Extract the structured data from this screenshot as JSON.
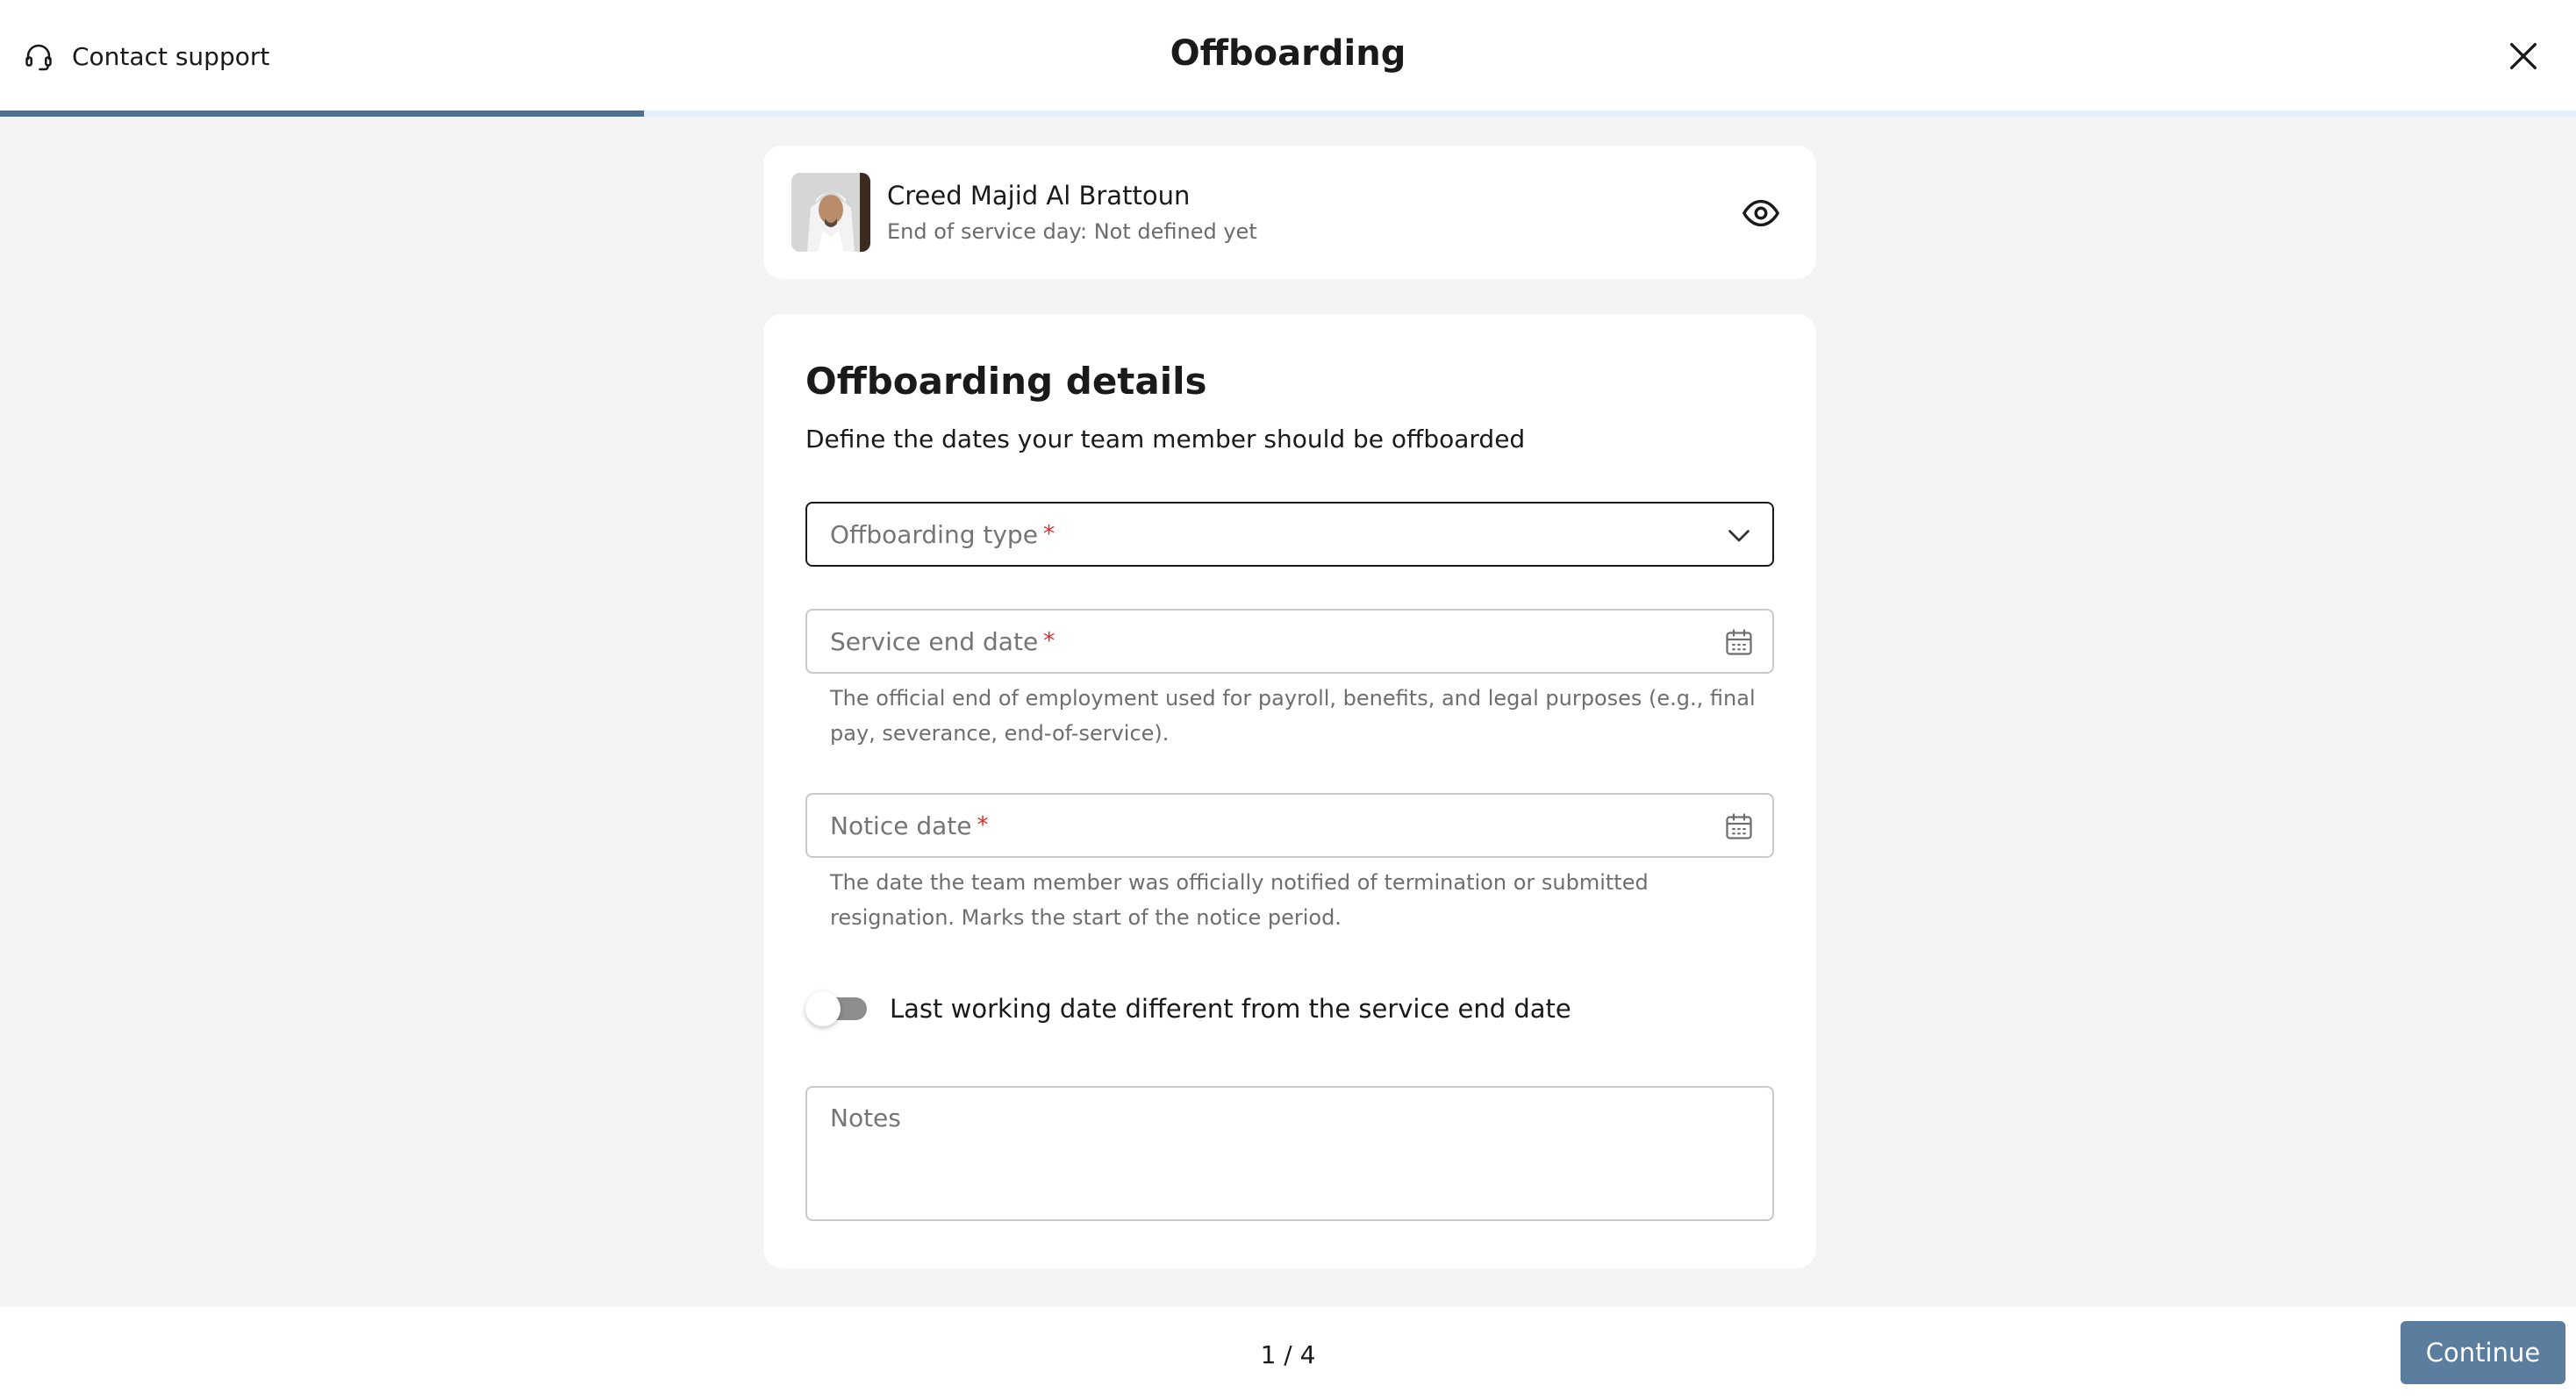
{
  "header": {
    "support_label": "Contact support",
    "title": "Offboarding",
    "progress_fraction": 0.25
  },
  "person": {
    "name": "Creed Majid Al Brattoun",
    "subtitle": "End of service day: Not defined yet"
  },
  "form": {
    "title": "Offboarding details",
    "subtitle": "Define the dates your team member should be offboarded",
    "offboarding_type": {
      "placeholder": "Offboarding type",
      "required_mark": "*"
    },
    "service_end_date": {
      "placeholder": "Service end date",
      "required_mark": "*",
      "help": "The official end of employment used for payroll, benefits, and legal purposes (e.g., final pay, severance, end-of-service)."
    },
    "notice_date": {
      "placeholder": "Notice date",
      "required_mark": "*",
      "help": "The date the team member was officially notified of termination or submitted resignation. Marks the start of the notice period."
    },
    "toggle": {
      "label": "Last working date different from the service end date",
      "checked": false
    },
    "notes": {
      "placeholder": "Notes",
      "value": ""
    }
  },
  "footer": {
    "page_indicator": "1 / 4",
    "continue_label": "Continue"
  },
  "colors": {
    "progress": "#4f6f8f",
    "progress_track": "#e3eef8",
    "primary_button": "#5b7d9e",
    "required": "#d32f2f"
  },
  "icons": {
    "support": "headset-icon",
    "close": "close-icon",
    "view": "eye-icon",
    "dropdown": "chevron-down-icon",
    "date": "calendar-icon"
  }
}
